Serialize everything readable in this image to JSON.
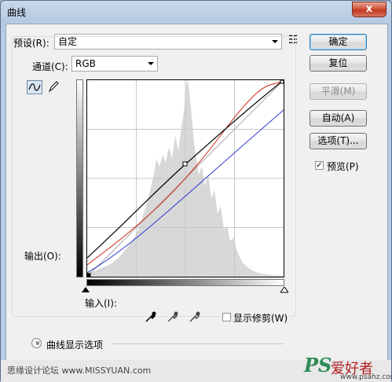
{
  "window": {
    "title": "曲线",
    "close_glyph": "x"
  },
  "preset": {
    "label": "预设(R):",
    "value": "自定",
    "menu_glyph": "☷"
  },
  "channel": {
    "label": "通道(C):",
    "value": "RGB"
  },
  "axes": {
    "output_label": "输出(O):",
    "input_label": "输入(I):"
  },
  "buttons": {
    "ok": "确定",
    "reset": "复位",
    "smooth": "平滑(M)",
    "auto": "自动(A)",
    "options": "选项(T)..."
  },
  "preview": {
    "label": "预览(P)",
    "checked": true,
    "check_glyph": "✓"
  },
  "clipping": {
    "label": "显示修剪(W)",
    "checked": false
  },
  "curve_display": {
    "label": "曲线显示选项",
    "glyph": "»"
  },
  "footer": {
    "watermark": "思缘设计论坛 www.MISSYUAN.com",
    "brand_ps": "PS",
    "brand_cn": "爱好者",
    "brand_url": "www.psahz.com"
  },
  "colors": {
    "curve_black": "#000000",
    "curve_red": "#cc2a1a",
    "curve_blue": "#2a3ad0",
    "histogram": "#d8d8d8",
    "grid": "#c8c8c8"
  }
}
